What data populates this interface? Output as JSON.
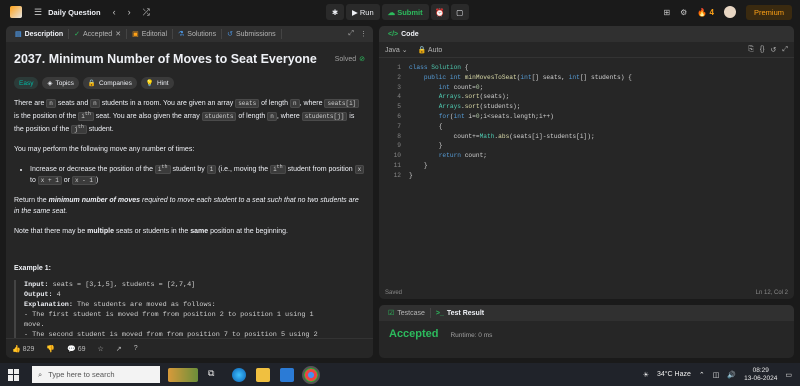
{
  "topbar": {
    "title": "Daily Question",
    "run": "Run",
    "submit": "Submit",
    "streak": "4",
    "premium": "Premium"
  },
  "left_tabs": [
    "Description",
    "Accepted",
    "Editorial",
    "Solutions",
    "Submissions"
  ],
  "problem": {
    "title": "2037. Minimum Number of Moves to Seat Everyone",
    "status": "Solved",
    "difficulty": "Easy",
    "chips": [
      "Topics",
      "Companies",
      "Hint"
    ],
    "p1": {
      "a": "There are ",
      "n1": "n",
      "b": " seats and ",
      "n2": "n",
      "c": " students in a room. You are given an array ",
      "seats": "seats",
      "d": " of length ",
      "n3": "n",
      "e": ", where ",
      "seats_i": "seats[i]",
      "f": " is the position of the ",
      "ith": "i",
      "th": "th",
      "g": " seat. You are also given the array ",
      "students": "students",
      "h": " of length ",
      "n4": "n",
      "i": ", where ",
      "students_j": "students[j]",
      "j": " is the position of the ",
      "jth": "j",
      "th2": "th",
      "k": " student."
    },
    "p2": "You may perform the following move any number of times:",
    "bullet": {
      "a": "Increase or decrease the position of the ",
      "i": "i",
      "th": "th",
      "b": " student by ",
      "one": "1",
      "c": " (i.e., moving the ",
      "i2": "i",
      "th2": "th",
      "d": " student from position ",
      "x": "x",
      "e": " to ",
      "x1": "x + 1",
      "f": " or ",
      "x2": "x - 1",
      "g": ")"
    },
    "p3": {
      "a": "Return the ",
      "b": "minimum number of moves",
      "c": " required to move each student to a seat such that no two students are in the same seat."
    },
    "p4": {
      "a": "Note that there may be ",
      "b": "multiple",
      "c": " seats or students in the ",
      "d": "same",
      "e": " position at the beginning."
    },
    "example_title": "Example 1:",
    "example": {
      "input_label": "Input:",
      "input": " seats = [3,1,5], students = [2,7,4]",
      "output_label": "Output:",
      "output": " 4",
      "expl_label": "Explanation:",
      "expl": " The students are moved as follows:",
      "l1": "- The first student is moved from from position 2 to position 1 using 1",
      "l1b": "move.",
      "l2": "- The second student is moved from from position 7 to position 5 using 2"
    }
  },
  "left_footer": {
    "likes": "829",
    "comments": "69"
  },
  "code_panel": {
    "title": "Code",
    "language": "Java",
    "mode": "Auto",
    "saved": "Saved",
    "cursor": "Ln 12, Col 2"
  },
  "code_lines": [
    "class Solution {",
    "    public int minMovesToSeat(int[] seats, int[] students) {",
    "        int count=0;",
    "        Arrays.sort(seats);",
    "        Arrays.sort(students);",
    "        for(int i=0;i<seats.length;i++)",
    "        {",
    "            count+=Math.abs(seats[i]-students[i]);",
    "        }",
    "        return count;",
    "    }",
    "}"
  ],
  "test_panel": {
    "tab1": "Testcase",
    "tab2": "Test Result",
    "result": "Accepted",
    "runtime": "Runtime: 0 ms"
  },
  "taskbar": {
    "search_placeholder": "Type here to search",
    "weather": "34°C  Haze",
    "time": "08:29",
    "date": "13-06-2024"
  },
  "colors": {
    "accent": "#ffa116",
    "success": "#2cbb5d",
    "easy": "#00b8a3"
  }
}
